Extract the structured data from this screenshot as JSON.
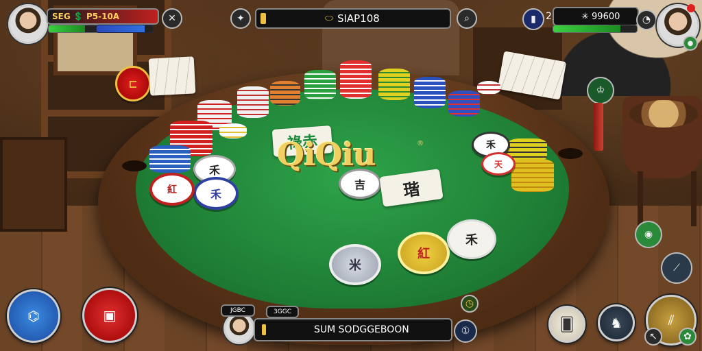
{
  "hud": {
    "left_player": {
      "name": "SEG 💲 P5-10A",
      "health": 0.35,
      "energy": 0.85
    },
    "right_player": {
      "count": "2",
      "name": "✳ 99600",
      "health": 0.8
    },
    "center_bar": {
      "label": "SIAP108"
    },
    "bottom_player": {
      "label1": "JGBC",
      "label2": "3GGC",
      "status": "SUM SODGGEBOON"
    }
  },
  "table": {
    "logo": "QiQiu",
    "logo_mark": "®",
    "cards": [
      {
        "glyph": "祿赤"
      },
      {
        "glyph": "瑎"
      }
    ],
    "chip_glyphs": [
      "禾",
      "天",
      "禾",
      "禾",
      "吉",
      "米",
      "紅",
      "禾"
    ]
  },
  "icons": {
    "top_left_action": "tools-icon",
    "top_center_settings": "gear-icon",
    "top_center_search": "search-icon",
    "top_right_card": "card-icon",
    "top_right_chat": "chat-icon",
    "bottom_left_blue": "fish-icon",
    "bottom_left_red": "device-icon",
    "bottom_right_cards": "cards-icon",
    "bottom_right_profile": "player-icon",
    "bottom_right_gold": "chopsticks-icon"
  }
}
